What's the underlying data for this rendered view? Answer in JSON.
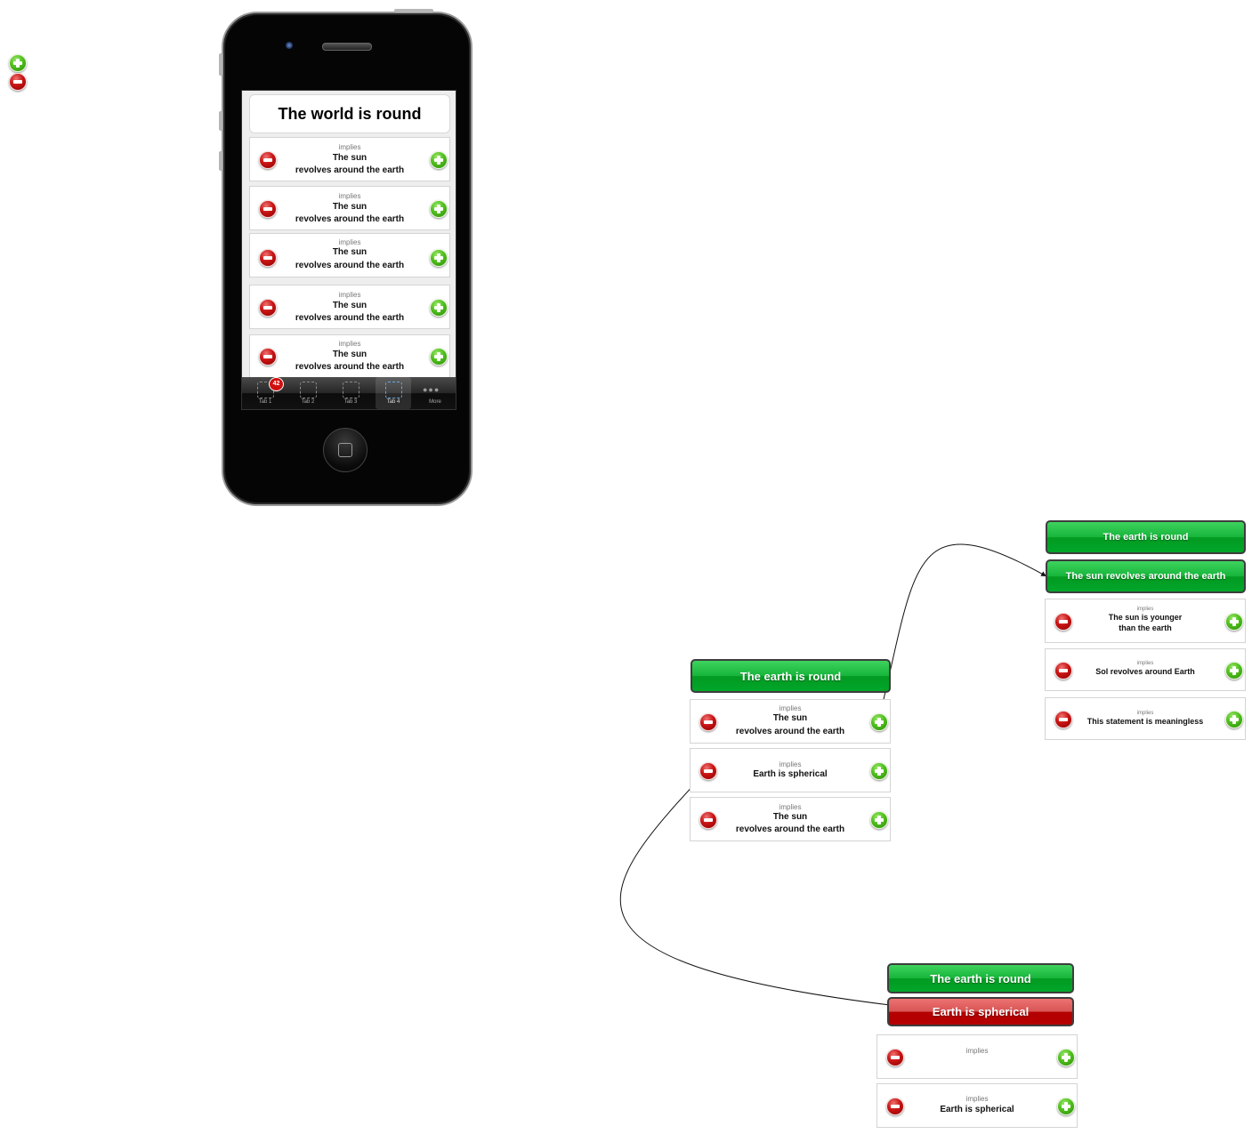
{
  "toolbar": {
    "add_icon": "plus-icon",
    "remove_icon": "minus-icon"
  },
  "phone": {
    "title": "The world is round",
    "rows": [
      {
        "implies": "implies",
        "line1": "The sun",
        "line2": "revolves around the earth"
      },
      {
        "implies": "implies",
        "line1": "The sun",
        "line2": "revolves around the earth"
      },
      {
        "implies": "implies",
        "line1": "The sun",
        "line2": "revolves around the earth"
      },
      {
        "implies": "implies",
        "line1": "The sun",
        "line2": "revolves around the earth"
      },
      {
        "implies": "implies",
        "line1": "The sun",
        "line2": "revolves around the earth"
      }
    ],
    "tabs": [
      {
        "label": "Tab 1",
        "badge": "42"
      },
      {
        "label": "Tab 2"
      },
      {
        "label": "Tab 3"
      },
      {
        "label": "Tab 4"
      },
      {
        "label": "More"
      }
    ]
  },
  "group_mid": {
    "header": "The earth is round",
    "rows": [
      {
        "implies": "implies",
        "line1": "The sun",
        "line2": "revolves around the earth"
      },
      {
        "implies": "implies",
        "line1": "Earth is spherical",
        "line2": ""
      },
      {
        "implies": "implies",
        "line1": "The sun",
        "line2": "revolves around the earth"
      }
    ]
  },
  "group_right": {
    "header1": "The earth is round",
    "header2": "The sun revolves around the earth",
    "rows": [
      {
        "implies": "implies",
        "line1": "The sun is younger",
        "line2": "than the earth"
      },
      {
        "implies": "implies",
        "line1": "Sol revolves around Earth",
        "line2": ""
      },
      {
        "implies": "implies",
        "line1": "This statement is meaningless",
        "line2": ""
      }
    ]
  },
  "group_bottom": {
    "header1": "The earth is round",
    "header2": "Earth is spherical",
    "rows": [
      {
        "implies": "implies",
        "line1": "",
        "line2": ""
      },
      {
        "implies": "implies",
        "line1": "Earth is spherical",
        "line2": ""
      }
    ]
  },
  "colors": {
    "green_header": "#16b53a",
    "red_header": "#b40000",
    "plus_green": "#4fbf1d",
    "minus_red": "#c81414"
  }
}
